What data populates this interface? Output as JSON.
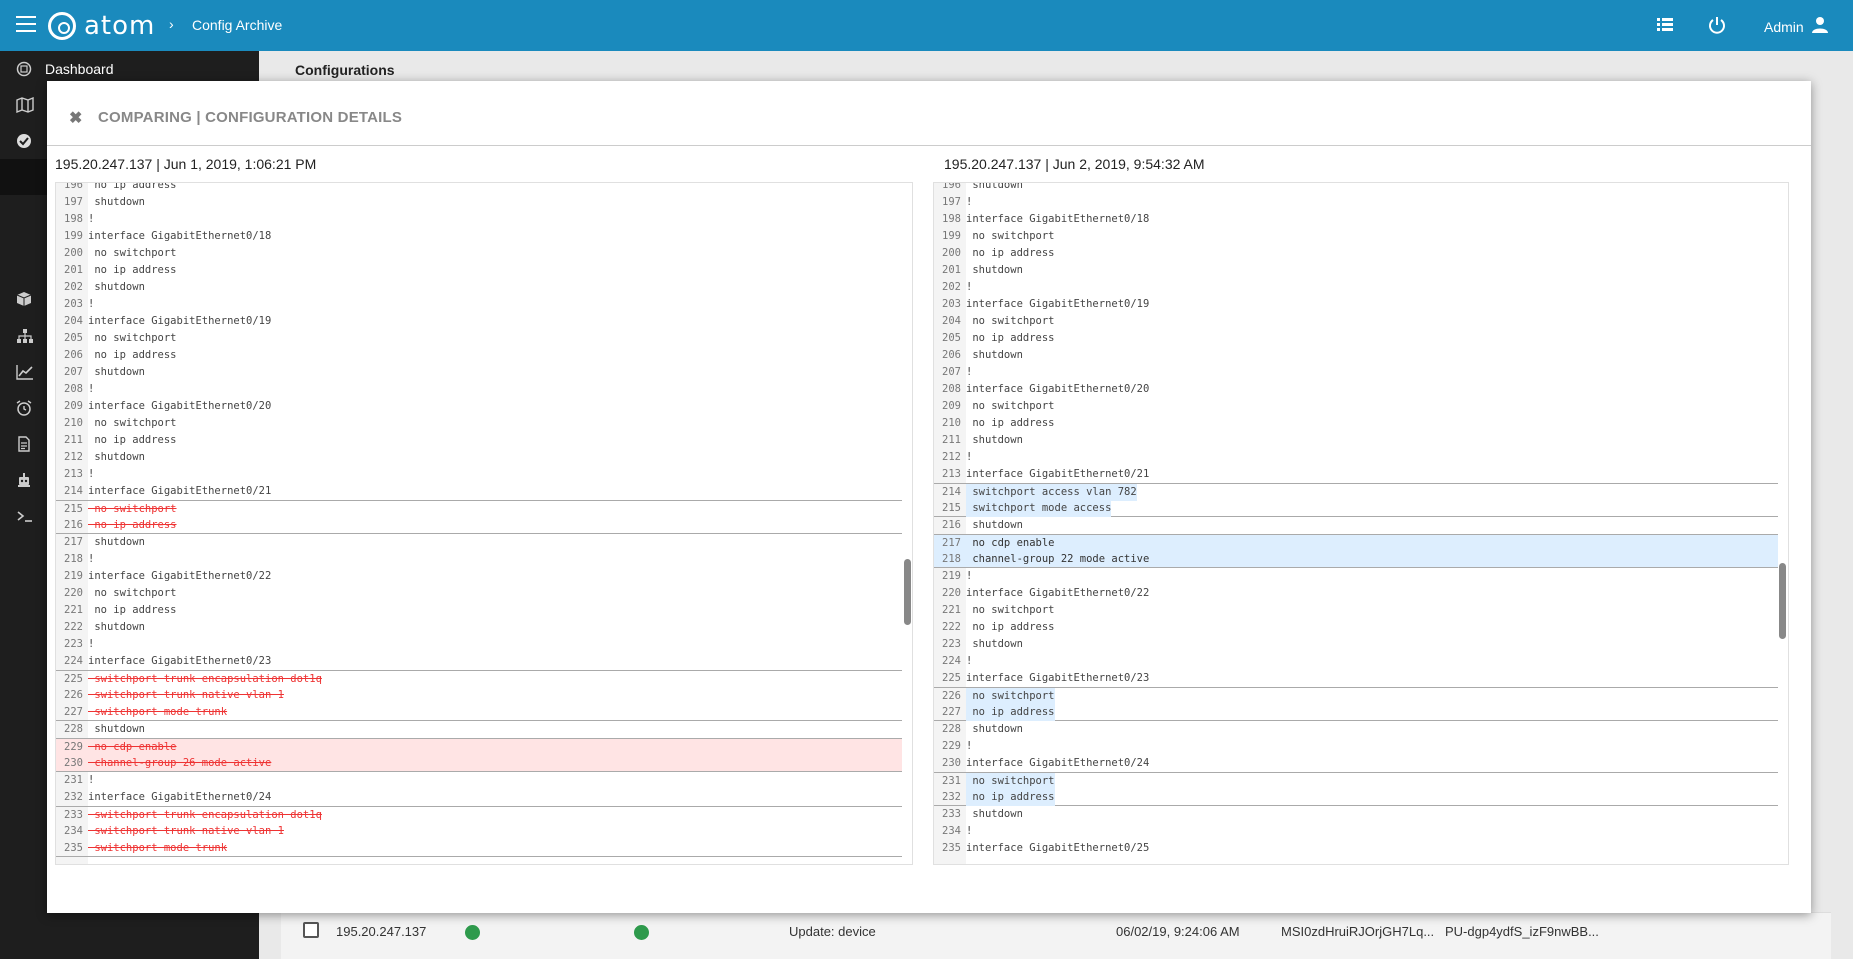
{
  "topbar": {
    "logo_text": "atom",
    "breadcrumb": "Config Archive",
    "user": "Admin",
    "icons": [
      "menu-icon",
      "list-icon",
      "power-icon",
      "user-icon"
    ]
  },
  "sidebar": {
    "items": [
      {
        "label": "Dashboard",
        "icon": "dashboard-icon"
      },
      {
        "label": "",
        "icon": "map-icon"
      },
      {
        "label": "",
        "icon": "check-icon"
      },
      {
        "label": "",
        "icon": "box-icon"
      },
      {
        "label": "",
        "icon": "hierarchy-icon"
      },
      {
        "label": "",
        "icon": "chart-icon"
      },
      {
        "label": "",
        "icon": "alarm-icon"
      },
      {
        "label": "",
        "icon": "document-icon"
      },
      {
        "label": "",
        "icon": "robot-icon"
      },
      {
        "label": "",
        "icon": "terminal-icon"
      }
    ]
  },
  "page": {
    "title": "Configurations",
    "row": {
      "ip": "195.20.247.137",
      "action": "Update: device",
      "time": "06/02/19, 9:24:06 AM",
      "id1": "MSI0zdHruiRJOrjGH7Lq...",
      "id2": "PU-dgp4ydfS_izF9nwBB..."
    }
  },
  "modal": {
    "title": "COMPARING | CONFIGURATION DETAILS",
    "left_header": "195.20.247.137 | Jun 1, 2019, 1:06:21 PM",
    "right_header": "195.20.247.137 | Jun 2, 2019, 9:54:32 AM",
    "colors": {
      "deleted": "#ffe4e4",
      "added": "#ddeefe",
      "deleted_text": "#e33333"
    },
    "left_lines": [
      {
        "n": "196",
        "t": " no ip address",
        "k": ""
      },
      {
        "n": "197",
        "t": " shutdown",
        "k": ""
      },
      {
        "n": "198",
        "t": "!",
        "k": ""
      },
      {
        "n": "199",
        "t": "interface GigabitEthernet0/18",
        "k": ""
      },
      {
        "n": "200",
        "t": " no switchport",
        "k": ""
      },
      {
        "n": "201",
        "t": " no ip address",
        "k": ""
      },
      {
        "n": "202",
        "t": " shutdown",
        "k": ""
      },
      {
        "n": "203",
        "t": "!",
        "k": ""
      },
      {
        "n": "204",
        "t": "interface GigabitEthernet0/19",
        "k": ""
      },
      {
        "n": "205",
        "t": " no switchport",
        "k": ""
      },
      {
        "n": "206",
        "t": " no ip address",
        "k": ""
      },
      {
        "n": "207",
        "t": " shutdown",
        "k": ""
      },
      {
        "n": "208",
        "t": "!",
        "k": ""
      },
      {
        "n": "209",
        "t": "interface GigabitEthernet0/20",
        "k": ""
      },
      {
        "n": "210",
        "t": " no switchport",
        "k": ""
      },
      {
        "n": "211",
        "t": " no ip address",
        "k": ""
      },
      {
        "n": "212",
        "t": " shutdown",
        "k": ""
      },
      {
        "n": "213",
        "t": "!",
        "k": ""
      },
      {
        "n": "214",
        "t": "interface GigabitEthernet0/21",
        "k": ""
      },
      {
        "n": "215",
        "t": " no switchport",
        "k": "mod"
      },
      {
        "n": "216",
        "t": " no ip address",
        "k": "mod"
      },
      {
        "n": "217",
        "t": " shutdown",
        "k": ""
      },
      {
        "n": "218",
        "t": "!",
        "k": ""
      },
      {
        "n": "219",
        "t": "interface GigabitEthernet0/22",
        "k": ""
      },
      {
        "n": "220",
        "t": " no switchport",
        "k": ""
      },
      {
        "n": "221",
        "t": " no ip address",
        "k": ""
      },
      {
        "n": "222",
        "t": " shutdown",
        "k": ""
      },
      {
        "n": "223",
        "t": "!",
        "k": ""
      },
      {
        "n": "224",
        "t": "interface GigabitEthernet0/23",
        "k": ""
      },
      {
        "n": "225",
        "t": " switchport trunk encapsulation dot1q",
        "k": "mod"
      },
      {
        "n": "226",
        "t": " switchport trunk native vlan 1",
        "k": "mod"
      },
      {
        "n": "227",
        "t": " switchport mode trunk",
        "k": "mod"
      },
      {
        "n": "228",
        "t": " shutdown",
        "k": ""
      },
      {
        "n": "229",
        "t": " no cdp enable",
        "k": "del"
      },
      {
        "n": "230",
        "t": " channel-group 26 mode active",
        "k": "del"
      },
      {
        "n": "231",
        "t": "!",
        "k": ""
      },
      {
        "n": "232",
        "t": "interface GigabitEthernet0/24",
        "k": ""
      },
      {
        "n": "233",
        "t": " switchport trunk encapsulation dot1q",
        "k": "mod"
      },
      {
        "n": "234",
        "t": " switchport trunk native vlan 1",
        "k": "mod"
      },
      {
        "n": "235",
        "t": " switchport mode trunk",
        "k": "mod"
      }
    ],
    "right_lines": [
      {
        "n": "196",
        "t": " shutdown",
        "k": ""
      },
      {
        "n": "197",
        "t": "!",
        "k": ""
      },
      {
        "n": "198",
        "t": "interface GigabitEthernet0/18",
        "k": ""
      },
      {
        "n": "199",
        "t": " no switchport",
        "k": ""
      },
      {
        "n": "200",
        "t": " no ip address",
        "k": ""
      },
      {
        "n": "201",
        "t": " shutdown",
        "k": ""
      },
      {
        "n": "202",
        "t": "!",
        "k": ""
      },
      {
        "n": "203",
        "t": "interface GigabitEthernet0/19",
        "k": ""
      },
      {
        "n": "204",
        "t": " no switchport",
        "k": ""
      },
      {
        "n": "205",
        "t": " no ip address",
        "k": ""
      },
      {
        "n": "206",
        "t": " shutdown",
        "k": ""
      },
      {
        "n": "207",
        "t": "!",
        "k": ""
      },
      {
        "n": "208",
        "t": "interface GigabitEthernet0/20",
        "k": ""
      },
      {
        "n": "209",
        "t": " no switchport",
        "k": ""
      },
      {
        "n": "210",
        "t": " no ip address",
        "k": ""
      },
      {
        "n": "211",
        "t": " shutdown",
        "k": ""
      },
      {
        "n": "212",
        "t": "!",
        "k": ""
      },
      {
        "n": "213",
        "t": "interface GigabitEthernet0/21",
        "k": ""
      },
      {
        "n": "214",
        "t": " switchport access vlan 782",
        "k": "mod"
      },
      {
        "n": "215",
        "t": " switchport mode access",
        "k": "mod"
      },
      {
        "n": "216",
        "t": " shutdown",
        "k": ""
      },
      {
        "n": "217",
        "t": " no cdp enable",
        "k": "ins"
      },
      {
        "n": "218",
        "t": " channel-group 22 mode active",
        "k": "ins"
      },
      {
        "n": "219",
        "t": "!",
        "k": ""
      },
      {
        "n": "220",
        "t": "interface GigabitEthernet0/22",
        "k": ""
      },
      {
        "n": "221",
        "t": " no switchport",
        "k": ""
      },
      {
        "n": "222",
        "t": " no ip address",
        "k": ""
      },
      {
        "n": "223",
        "t": " shutdown",
        "k": ""
      },
      {
        "n": "224",
        "t": "!",
        "k": ""
      },
      {
        "n": "225",
        "t": "interface GigabitEthernet0/23",
        "k": ""
      },
      {
        "n": "226",
        "t": " no switchport",
        "k": "mod"
      },
      {
        "n": "227",
        "t": " no ip address",
        "k": "mod"
      },
      {
        "n": "228",
        "t": " shutdown",
        "k": ""
      },
      {
        "n": "229",
        "t": "!",
        "k": ""
      },
      {
        "n": "230",
        "t": "interface GigabitEthernet0/24",
        "k": ""
      },
      {
        "n": "231",
        "t": " no switchport",
        "k": "mod"
      },
      {
        "n": "232",
        "t": " no ip address",
        "k": "mod"
      },
      {
        "n": "233",
        "t": " shutdown",
        "k": ""
      },
      {
        "n": "234",
        "t": "!",
        "k": ""
      },
      {
        "n": "235",
        "t": "interface GigabitEthernet0/25",
        "k": ""
      }
    ]
  }
}
